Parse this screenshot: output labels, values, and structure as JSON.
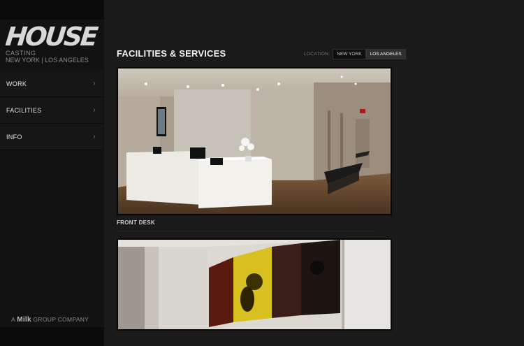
{
  "sidebar": {
    "logo": "HOUSE",
    "logo_sub1": "CASTING",
    "logo_sub2": "NEW YORK | LOS ANGELES",
    "nav": [
      {
        "label": "WORK",
        "chev": "›"
      },
      {
        "label": "FACILITIES",
        "chev": "›"
      },
      {
        "label": "INFO",
        "chev": "›"
      }
    ],
    "footer_pre": "A",
    "footer_brand": "Milk",
    "footer_post": "GROUP COMPANY"
  },
  "main": {
    "title": "FACILITIES & SERVICES",
    "location_label": "LOCATION:",
    "locations": [
      "NEW YORK",
      "LOS ANGELES"
    ],
    "active_location": "LOS ANGELES",
    "photos": [
      {
        "caption": "FRONT DESK",
        "icon": "front-desk-photo"
      },
      {
        "caption": "",
        "icon": "gallery-wall-photo"
      }
    ]
  }
}
